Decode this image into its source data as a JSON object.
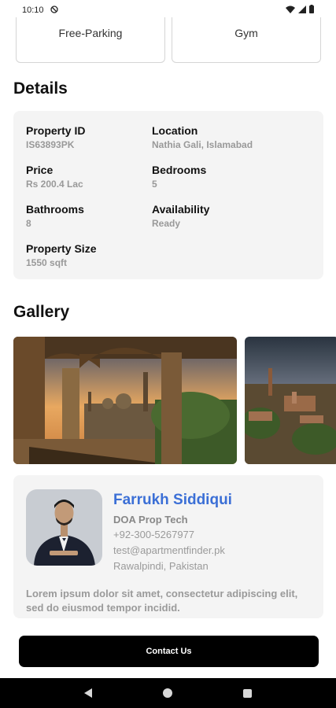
{
  "status_bar": {
    "time": "10:10"
  },
  "amenities": [
    "Free-Parking",
    "Gym"
  ],
  "details": {
    "title": "Details",
    "items": [
      {
        "label": "Property ID",
        "value": "IS63893PK"
      },
      {
        "label": "Location",
        "value": "Nathia Gali, Islamabad"
      },
      {
        "label": "Price",
        "value": "Rs 200.4 Lac"
      },
      {
        "label": "Bedrooms",
        "value": "5"
      },
      {
        "label": "Bathrooms",
        "value": "8"
      },
      {
        "label": "Availability",
        "value": "Ready"
      },
      {
        "label": "Property Size",
        "value": "1550 sqft"
      }
    ]
  },
  "gallery": {
    "title": "Gallery"
  },
  "agent": {
    "name": "Farrukh Siddiqui",
    "company": "DOA Prop Tech",
    "phone": "+92-300-5267977",
    "email": "test@apartmentfinder.pk",
    "location": "Rawalpindi, Pakistan",
    "description": "Lorem ipsum dolor sit amet, consectetur adipiscing elit, sed do eiusmod tempor incidid."
  },
  "contact_button": {
    "label": "Contact Us"
  },
  "colors": {
    "accent": "#3b6fd6",
    "card_bg": "#f4f4f4",
    "button_bg": "#000000"
  }
}
